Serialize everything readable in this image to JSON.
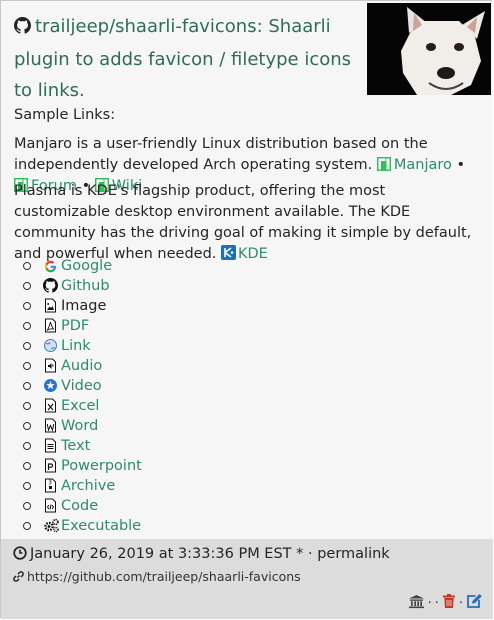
{
  "entry": {
    "title": "trailjeep/shaarli-favicons: Shaarli plugin to adds favicon / filetype icons to links.",
    "sample_label": "Sample Links:",
    "para1": {
      "text": "Manjaro is a user-friendly Linux distribution based on the independently developed Arch operating system.",
      "links": [
        "Manjaro",
        "Forum",
        "Wiki"
      ],
      "separator": "•"
    },
    "para2": {
      "text": "Plasma is KDE's flagship product, offering the most customizable desktop environment available. The KDE community has the driving goal of making it simple by default, and powerful when needed.",
      "link": "KDE"
    },
    "list": [
      {
        "label": "Google",
        "icon": "google-icon",
        "link": true
      },
      {
        "label": "Github",
        "icon": "github-icon",
        "link": true
      },
      {
        "label": "Image",
        "icon": "image-file-icon",
        "link": false
      },
      {
        "label": "PDF",
        "icon": "pdf-file-icon",
        "link": true
      },
      {
        "label": "Link",
        "icon": "globe-icon",
        "link": true
      },
      {
        "label": "Audio",
        "icon": "audio-file-icon",
        "link": true
      },
      {
        "label": "Video",
        "icon": "video-icon",
        "link": true
      },
      {
        "label": "Excel",
        "icon": "excel-file-icon",
        "link": true
      },
      {
        "label": "Word",
        "icon": "word-file-icon",
        "link": true
      },
      {
        "label": "Text",
        "icon": "text-file-icon",
        "link": true
      },
      {
        "label": "Powerpoint",
        "icon": "powerpoint-file-icon",
        "link": true
      },
      {
        "label": "Archive",
        "icon": "archive-file-icon",
        "link": true
      },
      {
        "label": "Code",
        "icon": "code-file-icon",
        "link": true
      },
      {
        "label": "Executable",
        "icon": "gears-icon",
        "link": true
      }
    ]
  },
  "footer": {
    "date": "January 26, 2019 at 3:33:36 PM EST",
    "date_suffix": "* ·",
    "permalink": "permalink",
    "url": "https://github.com/trailjeep/shaarli-favicons",
    "dot": "·"
  },
  "colors": {
    "link": "#2e8b6e",
    "title": "#2e6b59",
    "manjaro": "#35bf5c",
    "delete": "#c0392b",
    "edit": "#2a6fb7"
  }
}
